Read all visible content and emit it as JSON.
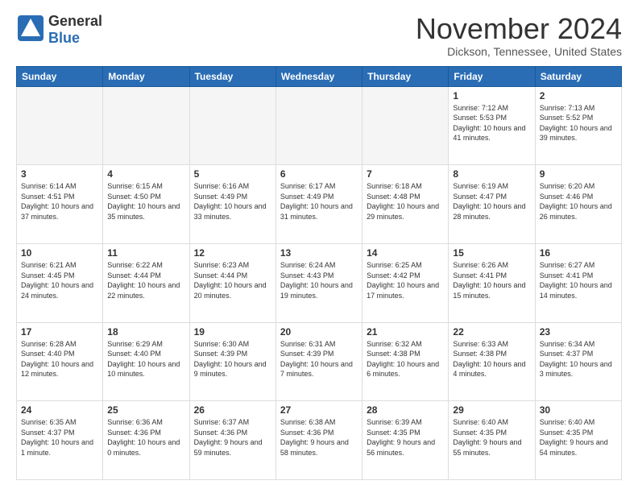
{
  "header": {
    "logo_general": "General",
    "logo_blue": "Blue",
    "month_title": "November 2024",
    "location": "Dickson, Tennessee, United States"
  },
  "weekdays": [
    "Sunday",
    "Monday",
    "Tuesday",
    "Wednesday",
    "Thursday",
    "Friday",
    "Saturday"
  ],
  "weeks": [
    [
      {
        "day": "",
        "info": "",
        "empty": true
      },
      {
        "day": "",
        "info": "",
        "empty": true
      },
      {
        "day": "",
        "info": "",
        "empty": true
      },
      {
        "day": "",
        "info": "",
        "empty": true
      },
      {
        "day": "",
        "info": "",
        "empty": true
      },
      {
        "day": "1",
        "info": "Sunrise: 7:12 AM\nSunset: 5:53 PM\nDaylight: 10 hours and 41 minutes."
      },
      {
        "day": "2",
        "info": "Sunrise: 7:13 AM\nSunset: 5:52 PM\nDaylight: 10 hours and 39 minutes."
      }
    ],
    [
      {
        "day": "3",
        "info": "Sunrise: 6:14 AM\nSunset: 4:51 PM\nDaylight: 10 hours and 37 minutes."
      },
      {
        "day": "4",
        "info": "Sunrise: 6:15 AM\nSunset: 4:50 PM\nDaylight: 10 hours and 35 minutes."
      },
      {
        "day": "5",
        "info": "Sunrise: 6:16 AM\nSunset: 4:49 PM\nDaylight: 10 hours and 33 minutes."
      },
      {
        "day": "6",
        "info": "Sunrise: 6:17 AM\nSunset: 4:49 PM\nDaylight: 10 hours and 31 minutes."
      },
      {
        "day": "7",
        "info": "Sunrise: 6:18 AM\nSunset: 4:48 PM\nDaylight: 10 hours and 29 minutes."
      },
      {
        "day": "8",
        "info": "Sunrise: 6:19 AM\nSunset: 4:47 PM\nDaylight: 10 hours and 28 minutes."
      },
      {
        "day": "9",
        "info": "Sunrise: 6:20 AM\nSunset: 4:46 PM\nDaylight: 10 hours and 26 minutes."
      }
    ],
    [
      {
        "day": "10",
        "info": "Sunrise: 6:21 AM\nSunset: 4:45 PM\nDaylight: 10 hours and 24 minutes."
      },
      {
        "day": "11",
        "info": "Sunrise: 6:22 AM\nSunset: 4:44 PM\nDaylight: 10 hours and 22 minutes."
      },
      {
        "day": "12",
        "info": "Sunrise: 6:23 AM\nSunset: 4:44 PM\nDaylight: 10 hours and 20 minutes."
      },
      {
        "day": "13",
        "info": "Sunrise: 6:24 AM\nSunset: 4:43 PM\nDaylight: 10 hours and 19 minutes."
      },
      {
        "day": "14",
        "info": "Sunrise: 6:25 AM\nSunset: 4:42 PM\nDaylight: 10 hours and 17 minutes."
      },
      {
        "day": "15",
        "info": "Sunrise: 6:26 AM\nSunset: 4:41 PM\nDaylight: 10 hours and 15 minutes."
      },
      {
        "day": "16",
        "info": "Sunrise: 6:27 AM\nSunset: 4:41 PM\nDaylight: 10 hours and 14 minutes."
      }
    ],
    [
      {
        "day": "17",
        "info": "Sunrise: 6:28 AM\nSunset: 4:40 PM\nDaylight: 10 hours and 12 minutes."
      },
      {
        "day": "18",
        "info": "Sunrise: 6:29 AM\nSunset: 4:40 PM\nDaylight: 10 hours and 10 minutes."
      },
      {
        "day": "19",
        "info": "Sunrise: 6:30 AM\nSunset: 4:39 PM\nDaylight: 10 hours and 9 minutes."
      },
      {
        "day": "20",
        "info": "Sunrise: 6:31 AM\nSunset: 4:39 PM\nDaylight: 10 hours and 7 minutes."
      },
      {
        "day": "21",
        "info": "Sunrise: 6:32 AM\nSunset: 4:38 PM\nDaylight: 10 hours and 6 minutes."
      },
      {
        "day": "22",
        "info": "Sunrise: 6:33 AM\nSunset: 4:38 PM\nDaylight: 10 hours and 4 minutes."
      },
      {
        "day": "23",
        "info": "Sunrise: 6:34 AM\nSunset: 4:37 PM\nDaylight: 10 hours and 3 minutes."
      }
    ],
    [
      {
        "day": "24",
        "info": "Sunrise: 6:35 AM\nSunset: 4:37 PM\nDaylight: 10 hours and 1 minute."
      },
      {
        "day": "25",
        "info": "Sunrise: 6:36 AM\nSunset: 4:36 PM\nDaylight: 10 hours and 0 minutes."
      },
      {
        "day": "26",
        "info": "Sunrise: 6:37 AM\nSunset: 4:36 PM\nDaylight: 9 hours and 59 minutes."
      },
      {
        "day": "27",
        "info": "Sunrise: 6:38 AM\nSunset: 4:36 PM\nDaylight: 9 hours and 58 minutes."
      },
      {
        "day": "28",
        "info": "Sunrise: 6:39 AM\nSunset: 4:35 PM\nDaylight: 9 hours and 56 minutes."
      },
      {
        "day": "29",
        "info": "Sunrise: 6:40 AM\nSunset: 4:35 PM\nDaylight: 9 hours and 55 minutes."
      },
      {
        "day": "30",
        "info": "Sunrise: 6:40 AM\nSunset: 4:35 PM\nDaylight: 9 hours and 54 minutes."
      }
    ]
  ]
}
